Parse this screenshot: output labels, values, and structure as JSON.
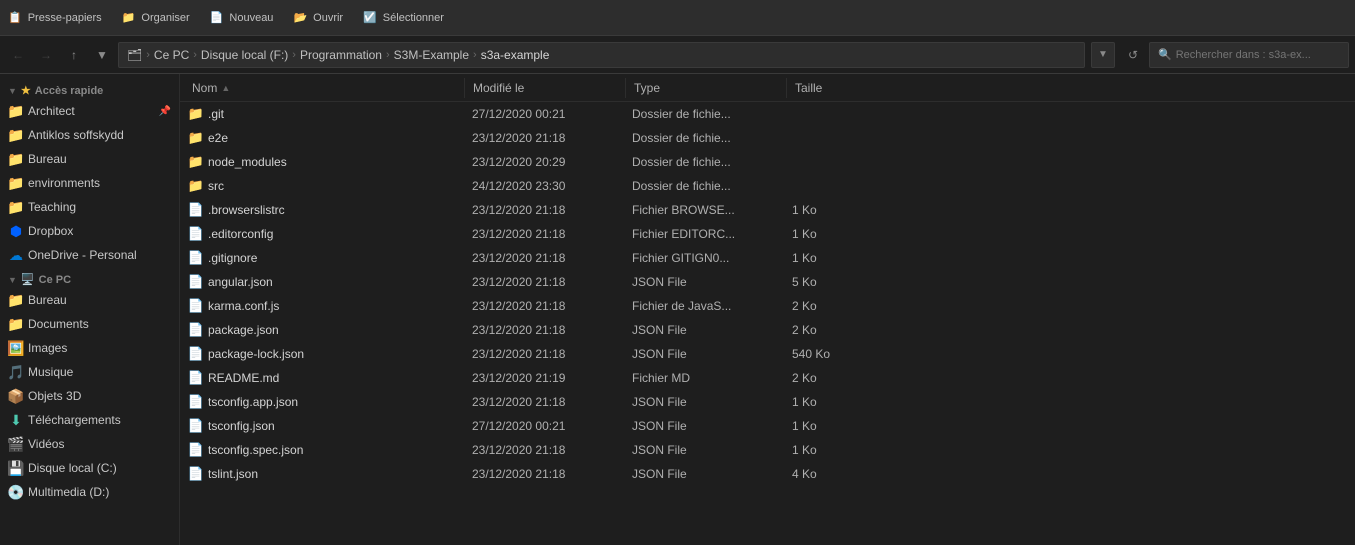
{
  "toolbar": {
    "groups": [
      {
        "label": "Presse-papiers",
        "icon": "📋"
      },
      {
        "label": "Organiser",
        "icon": "📁"
      },
      {
        "label": "Nouveau",
        "icon": "📄"
      },
      {
        "label": "Ouvrir",
        "icon": "📂"
      },
      {
        "label": "Sélectionner",
        "icon": "☑️"
      }
    ]
  },
  "addressbar": {
    "breadcrumbs": [
      {
        "label": "Ce PC"
      },
      {
        "label": "Disque local (F:)"
      },
      {
        "label": "Programmation"
      },
      {
        "label": "S3M-Example"
      },
      {
        "label": "s3a-example"
      }
    ],
    "search_placeholder": "Rechercher dans : s3a-ex..."
  },
  "sidebar": {
    "quick_access_label": "Accès rapide",
    "items_quick": [
      {
        "label": "Architect",
        "pinned": true,
        "icon": "📁"
      },
      {
        "label": "Antiklos soffskydd",
        "pinned": false,
        "icon": "📁"
      },
      {
        "label": "Bureau",
        "pinned": false,
        "icon": "📁"
      },
      {
        "label": "environments",
        "pinned": false,
        "icon": "📁"
      },
      {
        "label": "Teaching",
        "pinned": false,
        "icon": "📁"
      }
    ],
    "dropbox_label": "Dropbox",
    "onedrive_label": "OneDrive - Personal",
    "ce_pc_label": "Ce PC",
    "items_pc": [
      {
        "label": "Bureau",
        "icon": "📁"
      },
      {
        "label": "Documents",
        "icon": "📁"
      },
      {
        "label": "Images",
        "icon": "🖼️"
      },
      {
        "label": "Musique",
        "icon": "🎵"
      },
      {
        "label": "Objets 3D",
        "icon": "📦"
      },
      {
        "label": "Téléchargements",
        "icon": "⬇️"
      },
      {
        "label": "Vidéos",
        "icon": "🎬"
      },
      {
        "label": "Disque local (C:)",
        "icon": "💾"
      },
      {
        "label": "Multimedia (D:)",
        "icon": "💿"
      }
    ]
  },
  "filelist": {
    "columns": [
      {
        "label": "Nom",
        "sort": "asc"
      },
      {
        "label": "Modifié le"
      },
      {
        "label": "Type"
      },
      {
        "label": "Taille"
      }
    ],
    "files": [
      {
        "name": ".git",
        "modified": "27/12/2020 00:21",
        "type": "Dossier de fichie...",
        "size": "",
        "is_folder": true
      },
      {
        "name": "e2e",
        "modified": "23/12/2020 21:18",
        "type": "Dossier de fichie...",
        "size": "",
        "is_folder": true
      },
      {
        "name": "node_modules",
        "modified": "23/12/2020 20:29",
        "type": "Dossier de fichie...",
        "size": "",
        "is_folder": true
      },
      {
        "name": "src",
        "modified": "24/12/2020 23:30",
        "type": "Dossier de fichie...",
        "size": "",
        "is_folder": true
      },
      {
        "name": ".browserslistrc",
        "modified": "23/12/2020 21:18",
        "type": "Fichier BROWSE...",
        "size": "1 Ko",
        "is_folder": false,
        "icon_type": "config"
      },
      {
        "name": ".editorconfig",
        "modified": "23/12/2020 21:18",
        "type": "Fichier EDITORC...",
        "size": "1 Ko",
        "is_folder": false,
        "icon_type": "config"
      },
      {
        "name": ".gitignore",
        "modified": "23/12/2020 21:18",
        "type": "Fichier GITIGN0...",
        "size": "1 Ko",
        "is_folder": false,
        "icon_type": "git"
      },
      {
        "name": "angular.json",
        "modified": "23/12/2020 21:18",
        "type": "JSON File",
        "size": "5 Ko",
        "is_folder": false,
        "icon_type": "json"
      },
      {
        "name": "karma.conf.js",
        "modified": "23/12/2020 21:18",
        "type": "Fichier de JavaS...",
        "size": "2 Ko",
        "is_folder": false,
        "icon_type": "js"
      },
      {
        "name": "package.json",
        "modified": "23/12/2020 21:18",
        "type": "JSON File",
        "size": "2 Ko",
        "is_folder": false,
        "icon_type": "json"
      },
      {
        "name": "package-lock.json",
        "modified": "23/12/2020 21:18",
        "type": "JSON File",
        "size": "540 Ko",
        "is_folder": false,
        "icon_type": "json"
      },
      {
        "name": "README.md",
        "modified": "23/12/2020 21:19",
        "type": "Fichier MD",
        "size": "2 Ko",
        "is_folder": false,
        "icon_type": "md"
      },
      {
        "name": "tsconfig.app.json",
        "modified": "23/12/2020 21:18",
        "type": "JSON File",
        "size": "1 Ko",
        "is_folder": false,
        "icon_type": "json"
      },
      {
        "name": "tsconfig.json",
        "modified": "27/12/2020 00:21",
        "type": "JSON File",
        "size": "1 Ko",
        "is_folder": false,
        "icon_type": "json"
      },
      {
        "name": "tsconfig.spec.json",
        "modified": "23/12/2020 21:18",
        "type": "JSON File",
        "size": "1 Ko",
        "is_folder": false,
        "icon_type": "json"
      },
      {
        "name": "tslint.json",
        "modified": "23/12/2020 21:18",
        "type": "JSON File",
        "size": "4 Ko",
        "is_folder": false,
        "icon_type": "json"
      }
    ]
  }
}
